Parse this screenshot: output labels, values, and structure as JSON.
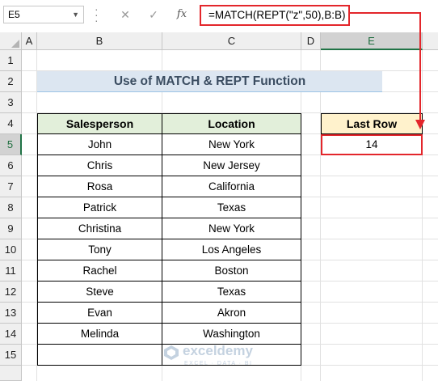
{
  "formula_bar": {
    "name_box": "E5",
    "cancel_icon": "close-icon",
    "enter_icon": "check-icon",
    "fx_label": "fx",
    "formula": "=MATCH(REPT(\"z\",50),B:B)"
  },
  "columns": [
    "A",
    "B",
    "C",
    "D",
    "E"
  ],
  "rows": [
    "1",
    "2",
    "3",
    "4",
    "5",
    "6",
    "7",
    "8",
    "9",
    "10",
    "11",
    "12",
    "13",
    "14",
    "15"
  ],
  "sheet": {
    "title": "Use of MATCH & REPT Function",
    "table": {
      "headers": [
        "Salesperson",
        "Location"
      ],
      "rows": [
        [
          "John",
          "New York"
        ],
        [
          "Chris",
          "New Jersey"
        ],
        [
          "Rosa",
          "California"
        ],
        [
          "Patrick",
          "Texas"
        ],
        [
          "Christina",
          "New York"
        ],
        [
          "Tony",
          "Los Angeles"
        ],
        [
          "Rachel",
          "Boston"
        ],
        [
          "Steve",
          "Texas"
        ],
        [
          "Evan",
          "Akron"
        ],
        [
          "Melinda",
          "Washington"
        ],
        [
          "",
          ""
        ]
      ]
    },
    "last_row": {
      "header": "Last Row",
      "value": "14"
    }
  },
  "watermark": {
    "name": "exceldemy",
    "tagline": "EXCEL · DATA · BI"
  },
  "colors": {
    "highlight": "#e3262b",
    "title_fill": "#dce6f1",
    "header_fill": "#e2efda",
    "result_header_fill": "#fff2cc",
    "selection": "#217346"
  }
}
